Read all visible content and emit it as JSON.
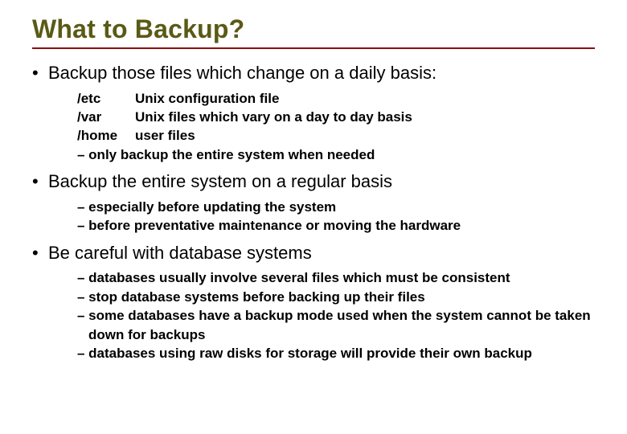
{
  "title": "What to Backup?",
  "bullets": [
    {
      "text": "Backup those files which change on a daily basis:",
      "dirs": [
        {
          "path": "/etc",
          "desc": "Unix configuration file"
        },
        {
          "path": "/var",
          "desc": "Unix files which vary on a day to day basis"
        },
        {
          "path": "/home",
          "desc": "user files"
        }
      ],
      "subs": [
        "– only backup the entire system when needed"
      ]
    },
    {
      "text": "Backup the entire system on a regular basis",
      "subs": [
        "– especially before updating the system",
        "– before preventative maintenance or moving the hardware"
      ]
    },
    {
      "text": "Be careful with database systems",
      "subs": [
        "– databases usually involve several files which must be consistent",
        "– stop database systems before backing up their files",
        "– some databases have a backup mode used when the system cannot be taken down for backups",
        "– databases using raw disks for storage will provide their own backup"
      ]
    }
  ]
}
